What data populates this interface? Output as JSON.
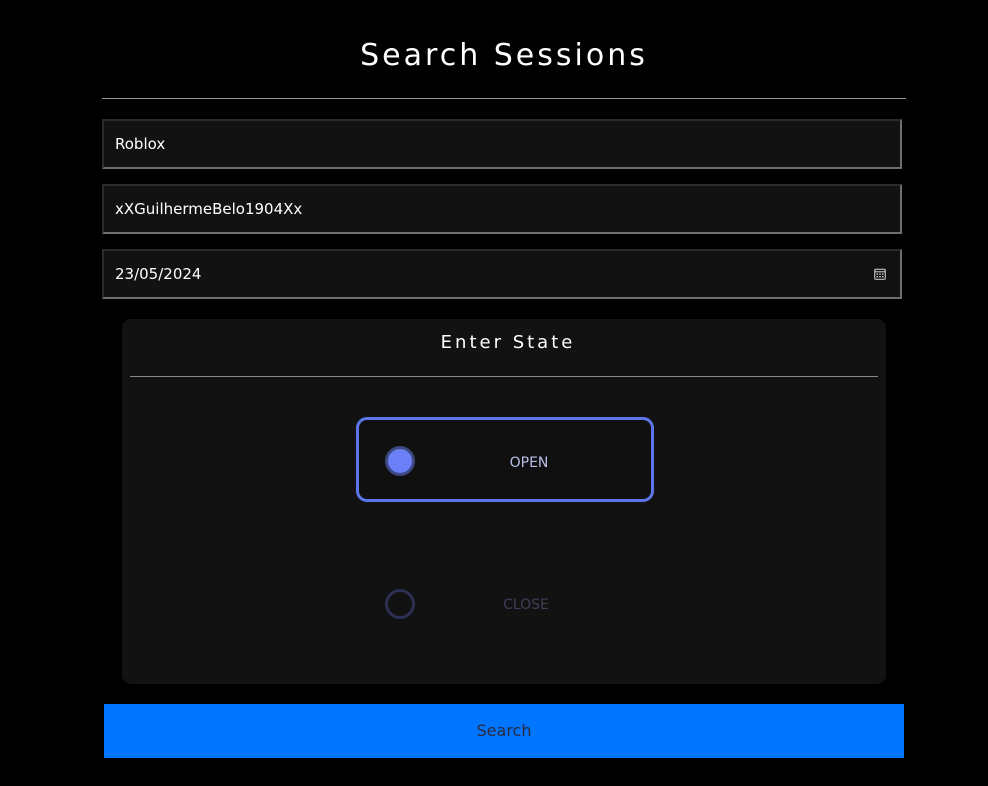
{
  "page": {
    "title": "Search Sessions"
  },
  "form": {
    "game_value": "Roblox",
    "username_value": "xXGuilhermeBelo1904Xx",
    "date_value": "23/05/2024",
    "date_icon": "calendar-icon"
  },
  "state_panel": {
    "title": "Enter State",
    "options": [
      {
        "label": "OPEN",
        "selected": true
      },
      {
        "label": "CLOSE",
        "selected": false
      }
    ]
  },
  "actions": {
    "search_label": "Search"
  },
  "colors": {
    "background": "#000000",
    "field_bg": "#121212",
    "accent": "#5b76e8",
    "radio_fill": "#6b7ff6",
    "button_bg": "#0075ff"
  }
}
